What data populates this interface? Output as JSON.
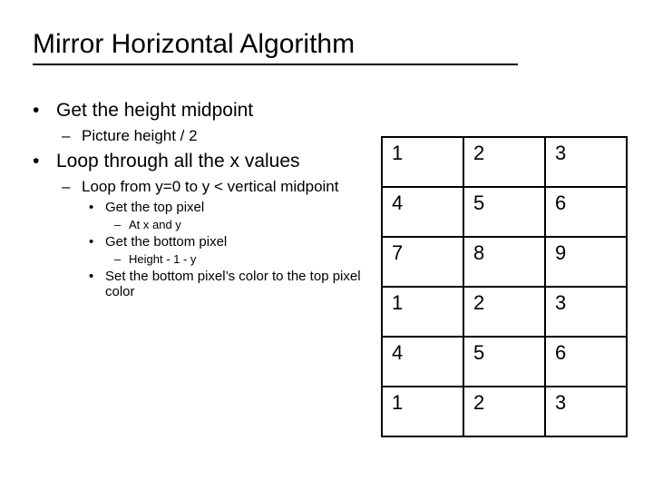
{
  "title": "Mirror Horizontal Algorithm",
  "bullets": {
    "a": "Get the height midpoint",
    "a1": "Picture height / 2",
    "b": "Loop through all the x values",
    "b1": "Loop from y=0 to y < vertical midpoint",
    "b1a": "Get the top pixel",
    "b1a1": "At x and y",
    "b1b": "Get the bottom pixel",
    "b1b1": "Height - 1 - y",
    "b1c": "Set the bottom pixel’s color to the top pixel color"
  },
  "grid": [
    [
      "1",
      "2",
      "3"
    ],
    [
      "4",
      "5",
      "6"
    ],
    [
      "7",
      "8",
      "9"
    ],
    [
      "1",
      "2",
      "3"
    ],
    [
      "4",
      "5",
      "6"
    ],
    [
      "1",
      "2",
      "3"
    ]
  ]
}
